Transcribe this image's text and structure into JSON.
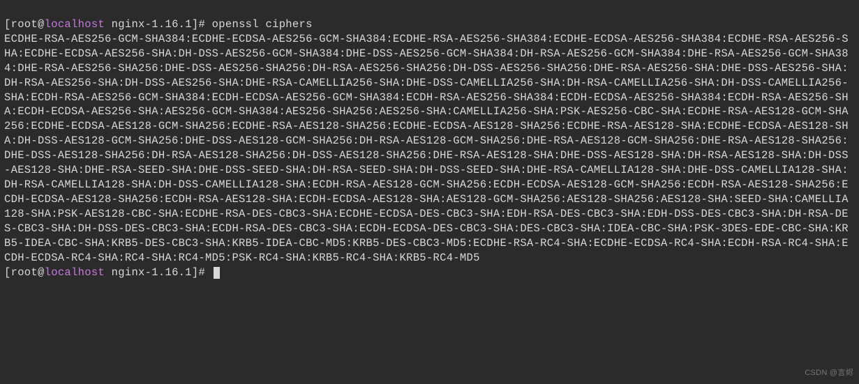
{
  "prompt1": {
    "bracket_open": "[",
    "user": "root",
    "at": "@",
    "host": "localhost",
    "space": " ",
    "path": "nginx-1.16.1",
    "bracket_close": "]#",
    "command": " openssl ciphers"
  },
  "output": "ECDHE-RSA-AES256-GCM-SHA384:ECDHE-ECDSA-AES256-GCM-SHA384:ECDHE-RSA-AES256-SHA384:ECDHE-ECDSA-AES256-SHA384:ECDHE-RSA-AES256-SHA:ECDHE-ECDSA-AES256-SHA:DH-DSS-AES256-GCM-SHA384:DHE-DSS-AES256-GCM-SHA384:DH-RSA-AES256-GCM-SHA384:DHE-RSA-AES256-GCM-SHA384:DHE-RSA-AES256-SHA256:DHE-DSS-AES256-SHA256:DH-RSA-AES256-SHA256:DH-DSS-AES256-SHA256:DHE-RSA-AES256-SHA:DHE-DSS-AES256-SHA:DH-RSA-AES256-SHA:DH-DSS-AES256-SHA:DHE-RSA-CAMELLIA256-SHA:DHE-DSS-CAMELLIA256-SHA:DH-RSA-CAMELLIA256-SHA:DH-DSS-CAMELLIA256-SHA:ECDH-RSA-AES256-GCM-SHA384:ECDH-ECDSA-AES256-GCM-SHA384:ECDH-RSA-AES256-SHA384:ECDH-ECDSA-AES256-SHA384:ECDH-RSA-AES256-SHA:ECDH-ECDSA-AES256-SHA:AES256-GCM-SHA384:AES256-SHA256:AES256-SHA:CAMELLIA256-SHA:PSK-AES256-CBC-SHA:ECDHE-RSA-AES128-GCM-SHA256:ECDHE-ECDSA-AES128-GCM-SHA256:ECDHE-RSA-AES128-SHA256:ECDHE-ECDSA-AES128-SHA256:ECDHE-RSA-AES128-SHA:ECDHE-ECDSA-AES128-SHA:DH-DSS-AES128-GCM-SHA256:DHE-DSS-AES128-GCM-SHA256:DH-RSA-AES128-GCM-SHA256:DHE-RSA-AES128-GCM-SHA256:DHE-RSA-AES128-SHA256:DHE-DSS-AES128-SHA256:DH-RSA-AES128-SHA256:DH-DSS-AES128-SHA256:DHE-RSA-AES128-SHA:DHE-DSS-AES128-SHA:DH-RSA-AES128-SHA:DH-DSS-AES128-SHA:DHE-RSA-SEED-SHA:DHE-DSS-SEED-SHA:DH-RSA-SEED-SHA:DH-DSS-SEED-SHA:DHE-RSA-CAMELLIA128-SHA:DHE-DSS-CAMELLIA128-SHA:DH-RSA-CAMELLIA128-SHA:DH-DSS-CAMELLIA128-SHA:ECDH-RSA-AES128-GCM-SHA256:ECDH-ECDSA-AES128-GCM-SHA256:ECDH-RSA-AES128-SHA256:ECDH-ECDSA-AES128-SHA256:ECDH-RSA-AES128-SHA:ECDH-ECDSA-AES128-SHA:AES128-GCM-SHA256:AES128-SHA256:AES128-SHA:SEED-SHA:CAMELLIA128-SHA:PSK-AES128-CBC-SHA:ECDHE-RSA-DES-CBC3-SHA:ECDHE-ECDSA-DES-CBC3-SHA:EDH-RSA-DES-CBC3-SHA:EDH-DSS-DES-CBC3-SHA:DH-RSA-DES-CBC3-SHA:DH-DSS-DES-CBC3-SHA:ECDH-RSA-DES-CBC3-SHA:ECDH-ECDSA-DES-CBC3-SHA:DES-CBC3-SHA:IDEA-CBC-SHA:PSK-3DES-EDE-CBC-SHA:KRB5-IDEA-CBC-SHA:KRB5-DES-CBC3-SHA:KRB5-IDEA-CBC-MD5:KRB5-DES-CBC3-MD5:ECDHE-RSA-RC4-SHA:ECDHE-ECDSA-RC4-SHA:ECDH-RSA-RC4-SHA:ECDH-ECDSA-RC4-SHA:RC4-SHA:RC4-MD5:PSK-RC4-SHA:KRB5-RC4-SHA:KRB5-RC4-MD5",
  "prompt2": {
    "bracket_open": "[",
    "user": "root",
    "at": "@",
    "host": "localhost",
    "space": " ",
    "path": "nginx-1.16.1",
    "bracket_close": "]#",
    "command": " "
  },
  "watermark": "CSDN @言烬"
}
